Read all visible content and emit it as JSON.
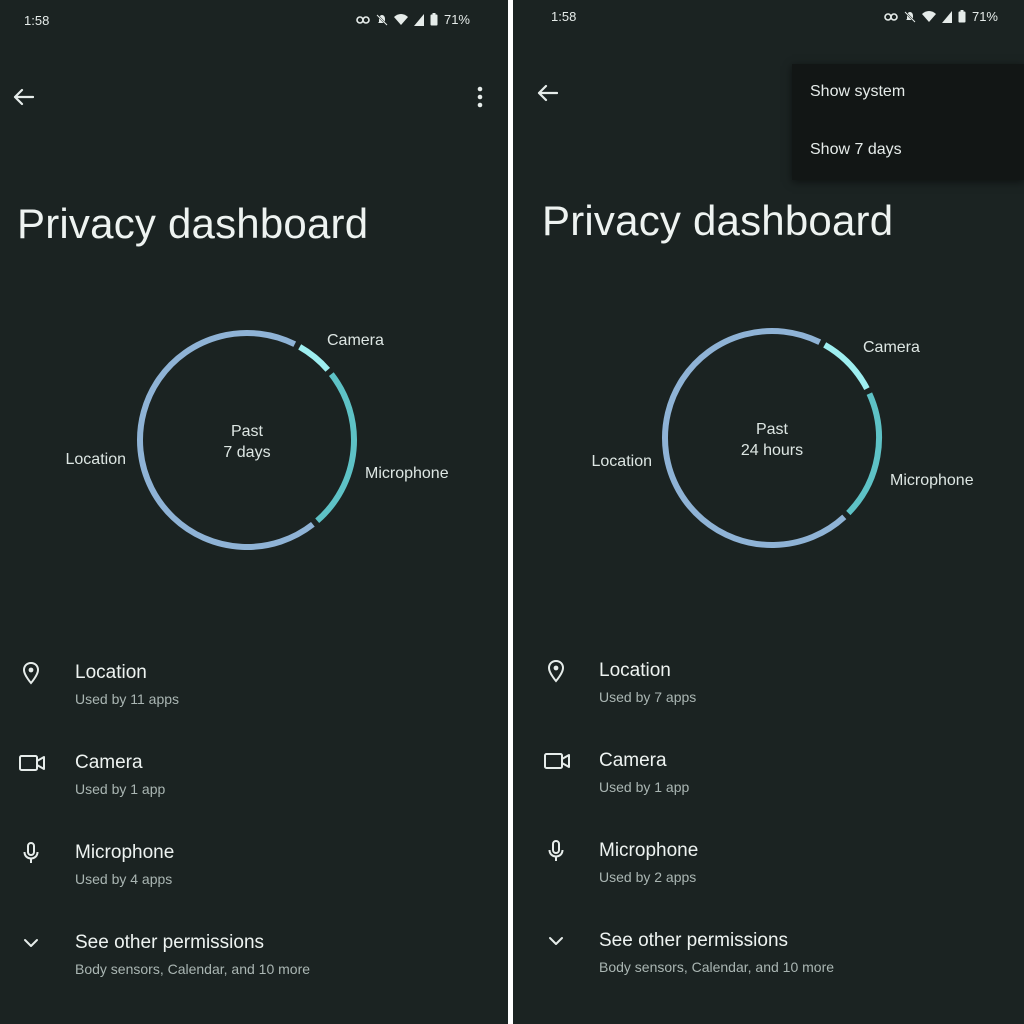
{
  "colors": {
    "background": "#1b2322",
    "location": "#8fb3d6",
    "camera": "#9eeef0",
    "microphone": "#5ec2c6",
    "menu_bg": "#121615"
  },
  "screens": [
    {
      "status": {
        "time": "1:58",
        "battery": "71%"
      },
      "title": "Privacy dashboard",
      "chart_data": {
        "type": "donut",
        "center_line1": "Past",
        "center_line2": "7 days",
        "segments": [
          {
            "label": "Location",
            "value": 11,
            "color": "#8fb3d6"
          },
          {
            "label": "Camera",
            "value": 1,
            "color": "#9eeef0"
          },
          {
            "label": "Microphone",
            "value": 4,
            "color": "#5ec2c6"
          }
        ]
      },
      "permissions": [
        {
          "title": "Location",
          "subtitle": "Used by 11 apps",
          "icon": "location-pin-icon"
        },
        {
          "title": "Camera",
          "subtitle": "Used by 1 app",
          "icon": "camera-icon"
        },
        {
          "title": "Microphone",
          "subtitle": "Used by 4 apps",
          "icon": "microphone-icon"
        },
        {
          "title": "See other permissions",
          "subtitle": "Body sensors, Calendar, and 10 more",
          "icon": "chevron-down-icon"
        }
      ]
    },
    {
      "status": {
        "time": "1:58",
        "battery": "71%"
      },
      "title": "Privacy dashboard",
      "menu": {
        "items": [
          "Show system",
          "Show 7 days"
        ]
      },
      "chart_data": {
        "type": "donut",
        "center_line1": "Past",
        "center_line2": "24 hours",
        "segments": [
          {
            "label": "Location",
            "value": 7,
            "color": "#8fb3d6"
          },
          {
            "label": "Camera",
            "value": 1,
            "color": "#9eeef0"
          },
          {
            "label": "Microphone",
            "value": 2,
            "color": "#5ec2c6"
          }
        ]
      },
      "permissions": [
        {
          "title": "Location",
          "subtitle": "Used by 7 apps",
          "icon": "location-pin-icon"
        },
        {
          "title": "Camera",
          "subtitle": "Used by 1 app",
          "icon": "camera-icon"
        },
        {
          "title": "Microphone",
          "subtitle": "Used by 2 apps",
          "icon": "microphone-icon"
        },
        {
          "title": "See other permissions",
          "subtitle": "Body sensors, Calendar, and 10 more",
          "icon": "chevron-down-icon"
        }
      ]
    }
  ]
}
